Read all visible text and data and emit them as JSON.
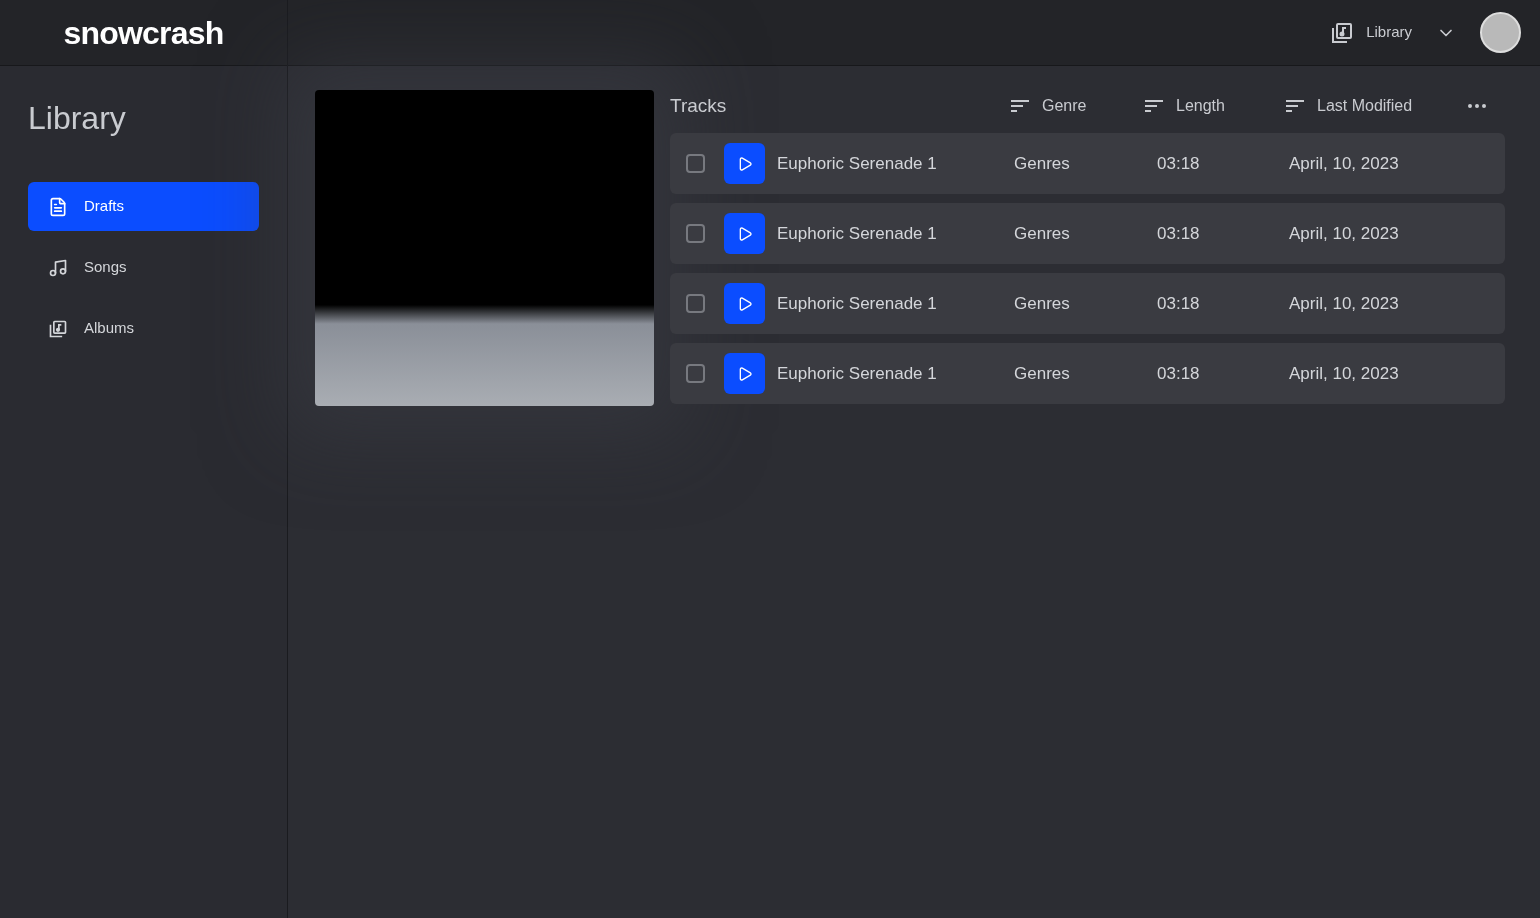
{
  "logo": "snowcrash",
  "header": {
    "library_menu": "Library"
  },
  "sidebar": {
    "title": "Library",
    "items": [
      {
        "label": "Drafts",
        "kind": "drafts",
        "selected": true
      },
      {
        "label": "Songs",
        "kind": "songs",
        "selected": false
      },
      {
        "label": "Albums",
        "kind": "albums",
        "selected": false
      }
    ]
  },
  "tracks": {
    "title": "Tracks",
    "columns": [
      "Genre",
      "Length",
      "Last Modified"
    ],
    "rows": [
      {
        "checked": false,
        "name": "Euphoric Serenade 1",
        "genre": "Genres",
        "length": "03:18",
        "modified": "April, 10, 2023"
      },
      {
        "checked": false,
        "name": "Euphoric Serenade 1",
        "genre": "Genres",
        "length": "03:18",
        "modified": "April, 10, 2023"
      },
      {
        "checked": false,
        "name": "Euphoric Serenade 1",
        "genre": "Genres",
        "length": "03:18",
        "modified": "April, 10, 2023"
      },
      {
        "checked": false,
        "name": "Euphoric Serenade 1",
        "genre": "Genres",
        "length": "03:18",
        "modified": "April, 10, 2023"
      }
    ]
  }
}
